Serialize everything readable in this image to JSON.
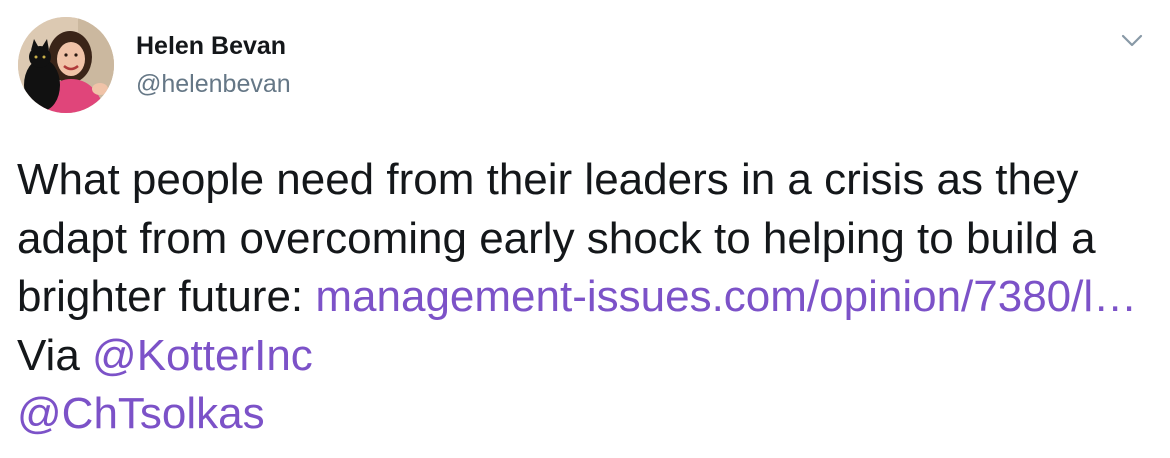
{
  "author": {
    "name": "Helen Bevan",
    "handle": "@helenbevan"
  },
  "tweet": {
    "text_part1": "What people need from their leaders in a crisis as they adapt from overcoming early shock to helping to build a brighter future: ",
    "link_url": "management-issues.com/opinion/7380/l…",
    "via_label": " Via ",
    "mention1": "@KotterInc",
    "mention2": "@ChTsolkas"
  },
  "icons": {
    "caret": "chevron-down-icon",
    "avatar": "avatar-photo"
  },
  "colors": {
    "link": "#7c52c8",
    "text": "#14171a",
    "secondary": "#657786"
  }
}
